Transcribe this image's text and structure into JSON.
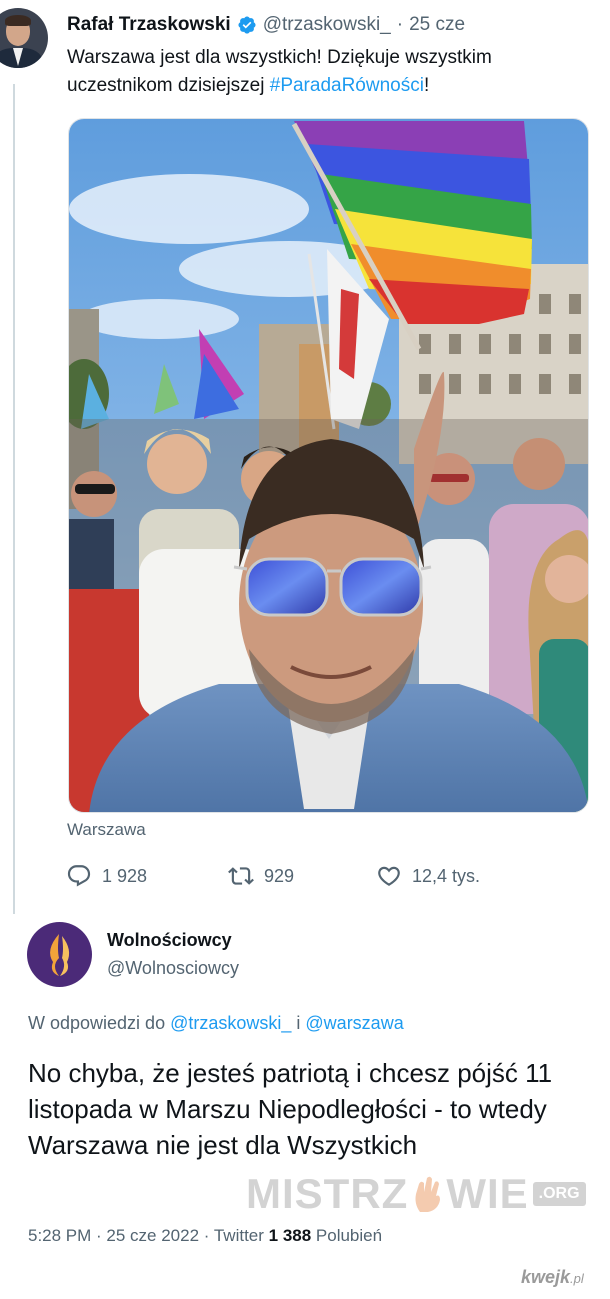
{
  "tweet": {
    "author_name": "Rafał Trzaskowski",
    "handle": "@trzaskowski_",
    "separator": "·",
    "time": "25 cze",
    "text_before": "Warszawa jest dla wszystkich! Dziękuje wszystkim uczestnikom dzisiejszej ",
    "hashtag": "#ParadaRówności",
    "text_after": "!",
    "location": "Warszawa",
    "replies": "1 928",
    "retweets": "929",
    "likes": "12,4 tys."
  },
  "reply": {
    "author_name": "Wolnościowcy",
    "handle": "@Wolnosciowcy",
    "reply_prefix": "W odpowiedzi do ",
    "mention_1": "@trzaskowski_",
    "reply_joiner": " i ",
    "mention_2": "@warszawa",
    "text": "No chyba, że jesteś patriotą i chcesz pójść 11 listopada w Marszu Niepodległości - to wtedy Warszawa nie jest dla Wszystkich",
    "timestamp": "5:28 PM · 25 cze 2022 · Twitter ",
    "like_count": "1 388",
    "like_label": " Polubień"
  },
  "watermarks": {
    "mistrzowie_a": "MISTRZ",
    "mistrzowie_b": "WIE",
    "mistrzowie_org": ".ORG",
    "kwejk_main": "kwejk",
    "kwejk_suffix": ".pl"
  },
  "colors": {
    "link": "#1d9bf0",
    "text_primary": "#0f1419",
    "text_secondary": "#536471",
    "verified": "#1d9bf0",
    "avatar2_bg": "#4b2a78",
    "avatar2_flame": "#f2a33a"
  },
  "icons": {
    "verified": "verified-badge-icon",
    "reply": "reply-icon",
    "retweet": "retweet-icon",
    "like": "heart-icon"
  }
}
